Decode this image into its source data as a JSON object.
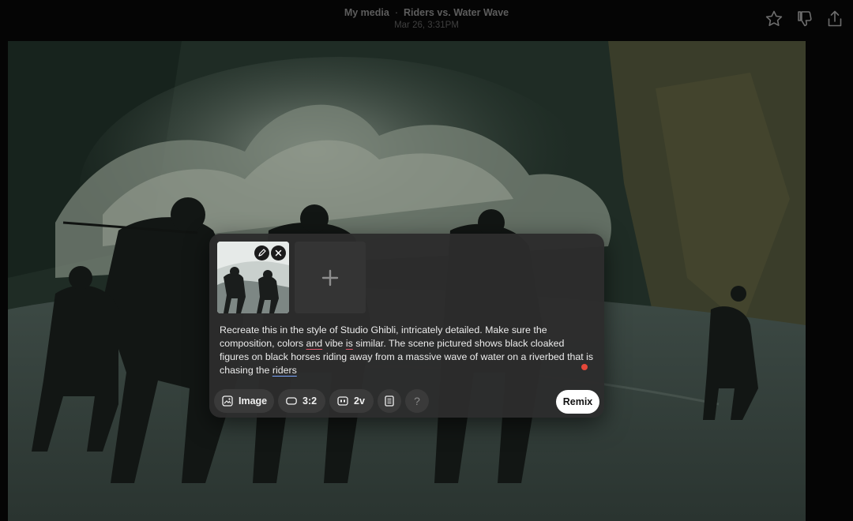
{
  "header": {
    "breadcrumb_parent": "My media",
    "separator": "·",
    "title": "Riders vs. Water Wave",
    "timestamp": "Mar 26, 3:31PM",
    "actions": [
      "star-icon",
      "thumbs-down-icon",
      "share-icon"
    ]
  },
  "panel": {
    "thumbnail": {
      "edit_icon": "pencil-icon",
      "remove_icon": "close-icon"
    },
    "add_slot_icon": "plus-icon",
    "prompt": {
      "before_and": "Recreate this in the style of Studio Ghibli, intricately detailed. Make sure the composition, colors ",
      "and": "and",
      "between": " vibe ",
      "is": "is",
      "after_is": " similar. The scene pictured shows black cloaked figures on black horses riding away from a massive wave of water on a riverbed that is chasing the ",
      "riders": "riders"
    },
    "toolbar": {
      "image_label": "Image",
      "aspect_label": "3:2",
      "variations_label": "2v",
      "preset_icon": "document-icon",
      "help_label": "?"
    },
    "remix_label": "Remix"
  },
  "colors": {
    "background": "#050505",
    "panel": "#2c2c2c",
    "chip": "#3a3a3a",
    "remix_bg": "#ffffff",
    "spell_underline": "#e0566a",
    "grammar_underline": "#7aa6ff",
    "status_dot": "#e5483a"
  }
}
